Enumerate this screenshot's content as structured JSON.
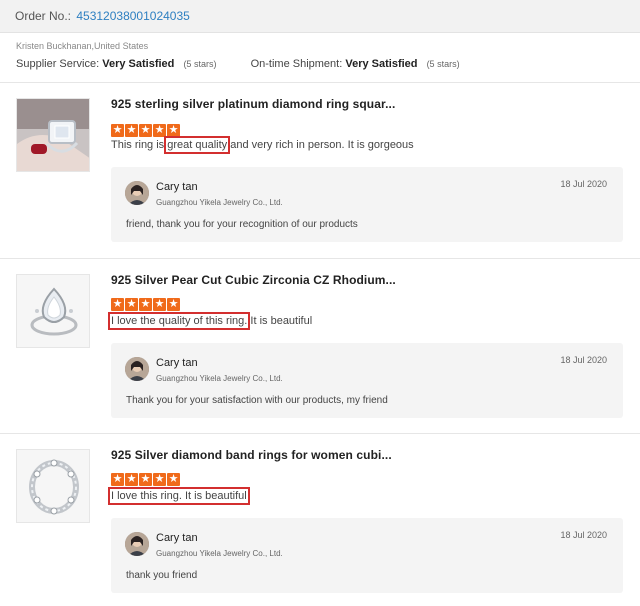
{
  "order": {
    "label": "Order No.:",
    "number": "45312038001024035"
  },
  "buyer": {
    "name_country": "Kristen Buckhanan,United States"
  },
  "ratings": {
    "supplier_label": "Supplier Service:",
    "supplier_value": "Very Satisfied",
    "supplier_stars": "(5 stars)",
    "shipment_label": "On-time Shipment:",
    "shipment_value": "Very Satisfied",
    "shipment_stars": "(5 stars)"
  },
  "star_color": "#f06a1a",
  "highlight_color": "#d32f2f",
  "link_color": "#2d7fc1",
  "reviews": [
    {
      "title": "925 sterling silver platinum diamond ring squar...",
      "rating": 5,
      "comment_before": "This ring is ",
      "comment_highlight": "great quality",
      "comment_after": " and very rich in person. It is gorgeous",
      "reply": {
        "name": "Cary tan",
        "company": "Guangzhou Yikela Jewelry Co., Ltd.",
        "date": "18 Jul 2020",
        "text": "friend, thank you for your recognition of our products"
      }
    },
    {
      "title": "925 Silver Pear Cut Cubic Zirconia CZ Rhodium...",
      "rating": 5,
      "comment_before": "",
      "comment_highlight": "I love the quality of this ring.",
      "comment_after": " It is beautiful",
      "reply": {
        "name": "Cary tan",
        "company": "Guangzhou Yikela Jewelry Co., Ltd.",
        "date": "18 Jul 2020",
        "text": "Thank you for your satisfaction with our products, my friend"
      }
    },
    {
      "title": "925 Silver diamond band rings for women cubi...",
      "rating": 5,
      "comment_before": "",
      "comment_highlight": "I love this ring. It is beautiful",
      "comment_after": "",
      "reply": {
        "name": "Cary tan",
        "company": "Guangzhou Yikela Jewelry Co., Ltd.",
        "date": "18 Jul 2020",
        "text": "thank you friend"
      }
    }
  ]
}
